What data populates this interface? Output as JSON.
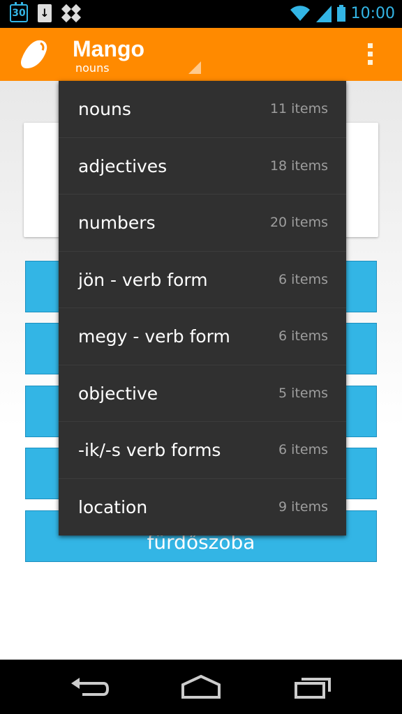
{
  "status_bar": {
    "calendar_day": "30",
    "time": "10:00",
    "icons": [
      "calendar-icon",
      "download-icon",
      "dropbox-icon",
      "wifi-icon",
      "signal-icon",
      "battery-icon"
    ]
  },
  "action_bar": {
    "title": "Mango",
    "subtitle": "nouns",
    "icons": [
      "mango-logo-icon",
      "overflow-menu-icon"
    ],
    "color": "#ff8a00"
  },
  "dropdown": {
    "items": [
      {
        "label": "nouns",
        "count": "11 items"
      },
      {
        "label": "adjectives",
        "count": "18 items"
      },
      {
        "label": "numbers",
        "count": "20 items"
      },
      {
        "label": "jön - verb form",
        "count": "6 items"
      },
      {
        "label": "megy - verb form",
        "count": "6 items"
      },
      {
        "label": "objective",
        "count": "5 items"
      },
      {
        "label": "-ik/-s verb forms",
        "count": "6 items"
      },
      {
        "label": "location",
        "count": "9 items"
      }
    ]
  },
  "content": {
    "answer_buttons": [
      "",
      "",
      "",
      "",
      "fürdőszoba"
    ],
    "button_color": "#33b5e5"
  },
  "nav_bar": {
    "icons": [
      "back-icon",
      "home-icon",
      "recent-apps-icon"
    ]
  }
}
